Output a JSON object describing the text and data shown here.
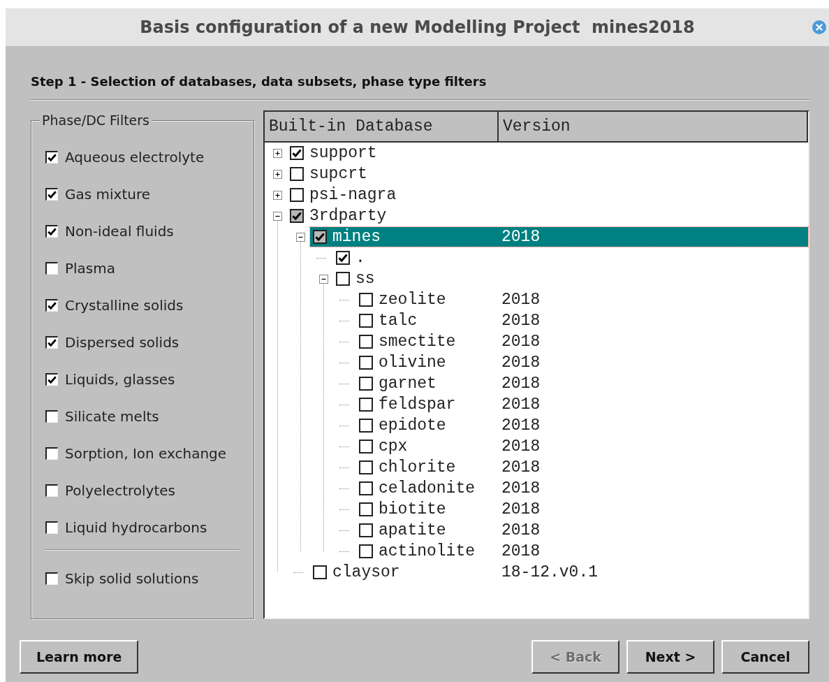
{
  "window": {
    "title": "Basis configuration of a new Modelling Project  mines2018"
  },
  "step": "Step 1 - Selection of databases, data subsets, phase type filters",
  "filters": {
    "title": "Phase/DC Filters",
    "items": [
      {
        "label": "Aqueous electrolyte",
        "checked": true
      },
      {
        "label": "Gas mixture",
        "checked": true
      },
      {
        "label": "Non-ideal fluids",
        "checked": true
      },
      {
        "label": "Plasma",
        "checked": false
      },
      {
        "label": "Crystalline solids",
        "checked": true
      },
      {
        "label": "Dispersed solids",
        "checked": true
      },
      {
        "label": "Liquids, glasses",
        "checked": true
      },
      {
        "label": "Silicate melts",
        "checked": false
      },
      {
        "label": "Sorption, Ion exchange",
        "checked": false
      },
      {
        "label": "Polyelectrolytes",
        "checked": false
      },
      {
        "label": "Liquid hydrocarbons",
        "checked": false
      }
    ],
    "extra": {
      "label": "Skip solid solutions",
      "checked": false
    }
  },
  "tree": {
    "columns": [
      "Built-in Database",
      "Version"
    ],
    "nodes": [
      {
        "name": "support",
        "checked": true,
        "partial": false,
        "expanded": false,
        "selected": false
      },
      {
        "name": "supcrt",
        "checked": false,
        "partial": false,
        "expanded": false,
        "selected": false
      },
      {
        "name": "psi-nagra",
        "checked": false,
        "partial": false,
        "expanded": false,
        "selected": false
      },
      {
        "name": "3rdparty",
        "checked": true,
        "partial": true,
        "expanded": true,
        "selected": false,
        "children": [
          {
            "name": "mines",
            "version": "2018",
            "checked": true,
            "partial": true,
            "expanded": true,
            "selected": true,
            "children": [
              {
                "name": ".",
                "checked": true,
                "partial": false,
                "selected": false
              },
              {
                "name": "ss",
                "checked": false,
                "partial": false,
                "expanded": true,
                "selected": false,
                "children": [
                  {
                    "name": "zeolite",
                    "version": "2018",
                    "checked": false,
                    "partial": false,
                    "selected": false
                  },
                  {
                    "name": "talc",
                    "version": "2018",
                    "checked": false,
                    "partial": false,
                    "selected": false
                  },
                  {
                    "name": "smectite",
                    "version": "2018",
                    "checked": false,
                    "partial": false,
                    "selected": false
                  },
                  {
                    "name": "olivine",
                    "version": "2018",
                    "checked": false,
                    "partial": false,
                    "selected": false
                  },
                  {
                    "name": "garnet",
                    "version": "2018",
                    "checked": false,
                    "partial": false,
                    "selected": false
                  },
                  {
                    "name": "feldspar",
                    "version": "2018",
                    "checked": false,
                    "partial": false,
                    "selected": false
                  },
                  {
                    "name": "epidote",
                    "version": "2018",
                    "checked": false,
                    "partial": false,
                    "selected": false
                  },
                  {
                    "name": "cpx",
                    "version": "2018",
                    "checked": false,
                    "partial": false,
                    "selected": false
                  },
                  {
                    "name": "chlorite",
                    "version": "2018",
                    "checked": false,
                    "partial": false,
                    "selected": false
                  },
                  {
                    "name": "celadonite",
                    "version": "2018",
                    "checked": false,
                    "partial": false,
                    "selected": false
                  },
                  {
                    "name": "biotite",
                    "version": "2018",
                    "checked": false,
                    "partial": false,
                    "selected": false
                  },
                  {
                    "name": "apatite",
                    "version": "2018",
                    "checked": false,
                    "partial": false,
                    "selected": false
                  },
                  {
                    "name": "actinolite",
                    "version": "2018",
                    "checked": false,
                    "partial": false,
                    "selected": false
                  }
                ]
              }
            ]
          },
          {
            "name": "claysor",
            "version": "18-12.v0.1",
            "checked": false,
            "partial": false,
            "selected": false
          }
        ]
      }
    ]
  },
  "buttons": [
    {
      "label": "Learn more",
      "disabled": false
    },
    {
      "label": "< Back",
      "disabled": true
    },
    {
      "label": "Next >",
      "disabled": false
    },
    {
      "label": "Cancel",
      "disabled": false
    }
  ]
}
